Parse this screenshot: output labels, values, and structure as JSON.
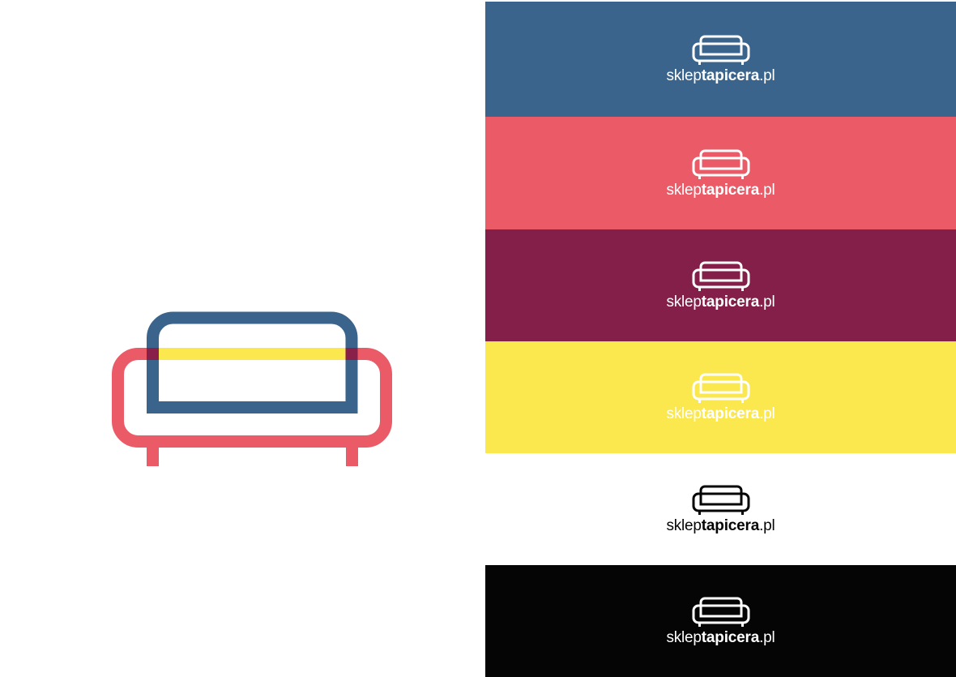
{
  "colors": {
    "blue": "#3b648d",
    "red": "#ea5a67",
    "plum": "#831f49",
    "yellow": "#fbe74e",
    "white": "#ffffff",
    "black": "#050505",
    "overlap_plum": "#88204a"
  },
  "icon": "sofa-icon",
  "variants": [
    {
      "name": "blue",
      "background": "#3b648d",
      "foreground": "#ffffff"
    },
    {
      "name": "red",
      "background": "#ea5a67",
      "foreground": "#ffffff"
    },
    {
      "name": "plum",
      "background": "#831f49",
      "foreground": "#ffffff"
    },
    {
      "name": "yellow",
      "background": "#fbe74e",
      "foreground": "#ffffff"
    },
    {
      "name": "white",
      "background": "#ffffff",
      "foreground": "#050505"
    },
    {
      "name": "black",
      "background": "#050505",
      "foreground": "#ffffff"
    }
  ],
  "logo": {
    "part1": "sklep",
    "part2": "tapicera",
    "part3": ".pl"
  }
}
